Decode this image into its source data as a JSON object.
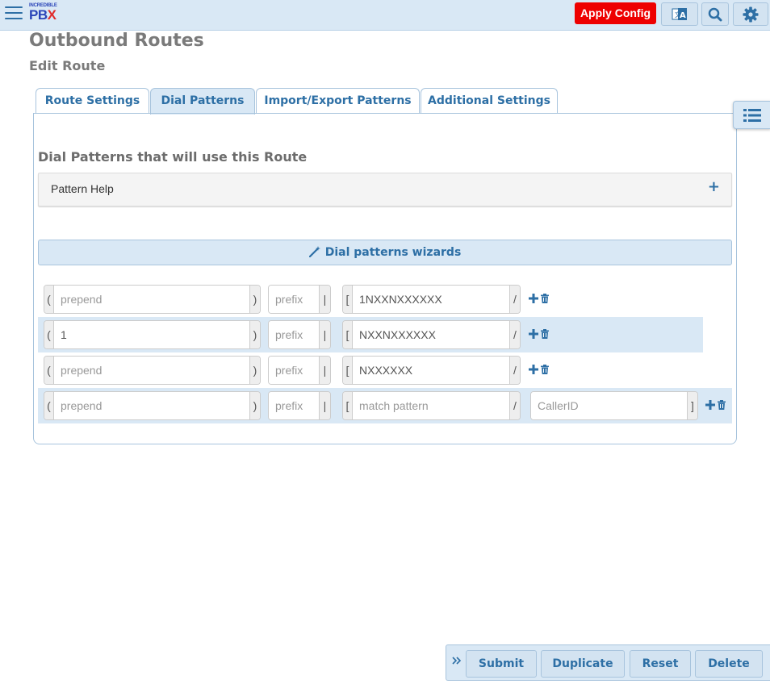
{
  "topbar": {
    "logo_small": "INCREDIBLE",
    "logo_main": "PB",
    "logo_x": "X",
    "apply_label": "Apply Config",
    "icons": [
      "menu-icon",
      "translate-icon",
      "search-icon",
      "gear-icon"
    ],
    "apply_color": "#ee0000"
  },
  "header": {
    "title": "Outbound Routes",
    "subtitle": "Edit Route"
  },
  "tabs": [
    {
      "label": "Route Settings",
      "active": false
    },
    {
      "label": "Dial Patterns",
      "active": true
    },
    {
      "label": "Import/Export Patterns",
      "active": false
    },
    {
      "label": "Additional Settings",
      "active": false
    }
  ],
  "section": {
    "title": "Dial Patterns that will use this Route",
    "help_label": "Pattern Help",
    "help_toggle": "+",
    "wizard_label": "Dial patterns wizards"
  },
  "placeholders": {
    "prepend": "prepend",
    "prefix": "prefix",
    "match": "match pattern",
    "callerid": "CallerID"
  },
  "delims": {
    "open_paren": "(",
    "close_paren": ")",
    "pipe": "|",
    "open_bracket": "[",
    "slash": "/",
    "close_bracket": "]"
  },
  "patterns": [
    {
      "prepend": "",
      "prefix": "",
      "match": "1NXXNXXXXXX"
    },
    {
      "prepend": "1",
      "prefix": "",
      "match": "NXXNXXXXXX"
    },
    {
      "prepend": "",
      "prefix": "",
      "match": "NXXXXXX"
    },
    {
      "prepend": "",
      "prefix": "",
      "match": "",
      "callerid": ""
    }
  ],
  "actions": {
    "submit": "Submit",
    "duplicate": "Duplicate",
    "reset": "Reset",
    "delete": "Delete"
  },
  "colors": {
    "accent": "#2d6fa5",
    "bar_bg": "#d9e8f5"
  }
}
